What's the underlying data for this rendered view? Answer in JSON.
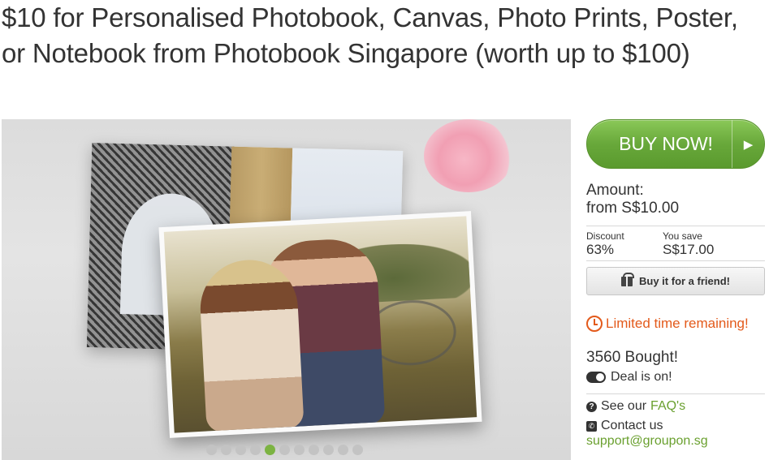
{
  "deal": {
    "title": "$10 for Personalised Photobook, Canvas, Photo Prints, Poster, or Notebook from Photobook Singapore (worth up to $100)"
  },
  "gallery": {
    "dot_count": 11,
    "active_index": 4
  },
  "purchase": {
    "buy_label": "BUY NOW!",
    "amount_label": "Amount:",
    "amount_value": "from S$10.00",
    "discount_label": "Discount",
    "discount_value": "63%",
    "save_label": "You save",
    "save_value": "S$17.00",
    "gift_label": "Buy it for a friend!"
  },
  "status": {
    "limited_text": "Limited time remaining!",
    "bought_text": "3560 Bought!",
    "deal_on_text": "Deal is on!"
  },
  "support": {
    "faq_prefix": "See our",
    "faq_link": "FAQ's",
    "contact_label": "Contact us",
    "email": "support@groupon.sg"
  },
  "colors": {
    "accent_green": "#6aa02f",
    "warning_orange": "#e35a1b",
    "active_dot": "#7cb342"
  },
  "icons": [
    "chevron-right-icon",
    "gift-icon",
    "clock-icon",
    "toggle-icon",
    "question-icon",
    "phone-icon"
  ]
}
